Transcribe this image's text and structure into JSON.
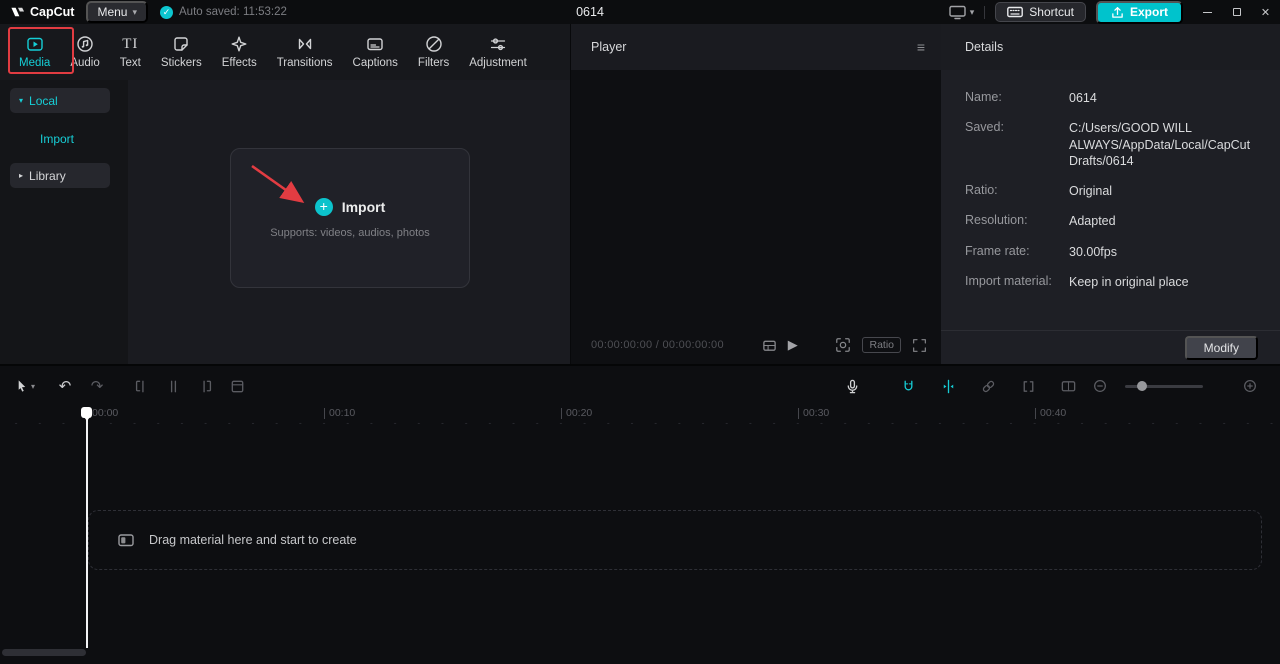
{
  "titlebar": {
    "logo_text": "CapCut",
    "menu_label": "Menu",
    "autosave_text": "Auto saved: 11:53:22",
    "project_title": "0614",
    "shortcut_label": "Shortcut",
    "export_label": "Export"
  },
  "tabs": [
    {
      "label": "Media"
    },
    {
      "label": "Audio"
    },
    {
      "label": "Text"
    },
    {
      "label": "Stickers"
    },
    {
      "label": "Effects"
    },
    {
      "label": "Transitions"
    },
    {
      "label": "Captions"
    },
    {
      "label": "Filters"
    },
    {
      "label": "Adjustment"
    }
  ],
  "sidebar": {
    "local": "Local",
    "import": "Import",
    "library": "Library"
  },
  "media": {
    "import_button": "Import",
    "supports": "Supports: videos, audios, photos"
  },
  "player": {
    "title": "Player",
    "timecode": "00:00:00:00 / 00:00:00:00",
    "ratio_label": "Ratio"
  },
  "details": {
    "title": "Details",
    "rows": [
      {
        "label": "Name:",
        "value": "0614"
      },
      {
        "label": "Saved:",
        "value": "C:/Users/GOOD WILL ALWAYS/AppData/Local/CapCut Drafts/0614"
      },
      {
        "label": "Ratio:",
        "value": "Original"
      },
      {
        "label": "Resolution:",
        "value": "Adapted"
      },
      {
        "label": "Frame rate:",
        "value": "30.00fps"
      },
      {
        "label": "Import material:",
        "value": "Keep in original place"
      }
    ],
    "modify_label": "Modify"
  },
  "timeline": {
    "ruler": [
      "00:00",
      "00:10",
      "00:20",
      "00:30",
      "00:40"
    ],
    "drop_hint": "Drag material here and start to create"
  },
  "icons": {
    "chevron_down": "▾",
    "chevron_right": "▸",
    "check": "✓",
    "more": "≡",
    "play": "▶",
    "close": "✕",
    "plus": "+",
    "undo": "↶",
    "redo": "↷",
    "text_tool": "TI"
  },
  "colors": {
    "accent": "#15ced6",
    "export_button": "#00c3cc",
    "annotation_red": "#e23c42"
  }
}
